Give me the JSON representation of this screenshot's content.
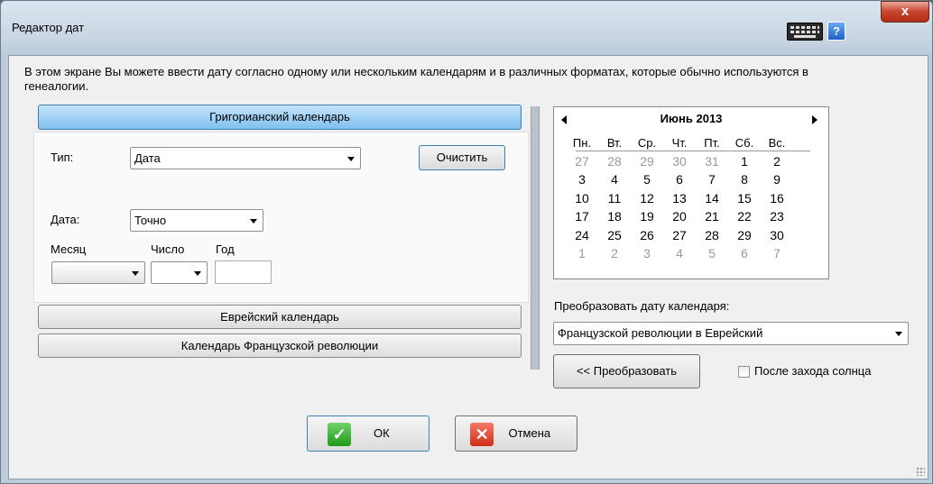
{
  "window": {
    "title": "Редактор дат",
    "close_label": "x",
    "help_label": "?"
  },
  "intro": "В этом экране Вы можете ввести дату согласно одному или нескольким календарям и в различных форматах, которые обычно используются в генеалогии.",
  "calendars": {
    "gregorian": "Григорианский календарь",
    "hebrew": "Еврейский календарь",
    "french": "Календарь Французской революции"
  },
  "gregorian_panel": {
    "type_label": "Тип:",
    "type_value": "Дата",
    "clear_button": "Очистить",
    "date_label": "Дата:",
    "date_mode": "Точно",
    "month_label": "Месяц",
    "day_label": "Число",
    "year_label": "Год",
    "month_value": "",
    "day_value": "",
    "year_value": ""
  },
  "calendar": {
    "month_title": "Июнь 2013",
    "weekdays": [
      "Пн.",
      "Вт.",
      "Ср.",
      "Чт.",
      "Пт.",
      "Сб.",
      "Вс."
    ],
    "weeks": [
      [
        {
          "d": "27",
          "m": true
        },
        {
          "d": "28",
          "m": true
        },
        {
          "d": "29",
          "m": true
        },
        {
          "d": "30",
          "m": true
        },
        {
          "d": "31",
          "m": true
        },
        {
          "d": "1"
        },
        {
          "d": "2"
        }
      ],
      [
        {
          "d": "3"
        },
        {
          "d": "4"
        },
        {
          "d": "5"
        },
        {
          "d": "6"
        },
        {
          "d": "7"
        },
        {
          "d": "8"
        },
        {
          "d": "9"
        }
      ],
      [
        {
          "d": "10"
        },
        {
          "d": "11"
        },
        {
          "d": "12"
        },
        {
          "d": "13"
        },
        {
          "d": "14"
        },
        {
          "d": "15"
        },
        {
          "d": "16"
        }
      ],
      [
        {
          "d": "17"
        },
        {
          "d": "18"
        },
        {
          "d": "19"
        },
        {
          "d": "20"
        },
        {
          "d": "21"
        },
        {
          "d": "22"
        },
        {
          "d": "23"
        }
      ],
      [
        {
          "d": "24"
        },
        {
          "d": "25"
        },
        {
          "d": "26"
        },
        {
          "d": "27"
        },
        {
          "d": "28"
        },
        {
          "d": "29"
        },
        {
          "d": "30"
        }
      ],
      [
        {
          "d": "1",
          "m": true
        },
        {
          "d": "2",
          "m": true
        },
        {
          "d": "3",
          "m": true
        },
        {
          "d": "4",
          "m": true
        },
        {
          "d": "5",
          "m": true
        },
        {
          "d": "6",
          "m": true
        },
        {
          "d": "7",
          "m": true
        }
      ]
    ]
  },
  "convert": {
    "label": "Преобразовать дату календаря:",
    "selected": "Французской революции в Еврейский",
    "button": "<< Преобразовать",
    "sunset_label": "После захода солнца"
  },
  "footer": {
    "ok": "ОК",
    "cancel": "Отмена"
  }
}
